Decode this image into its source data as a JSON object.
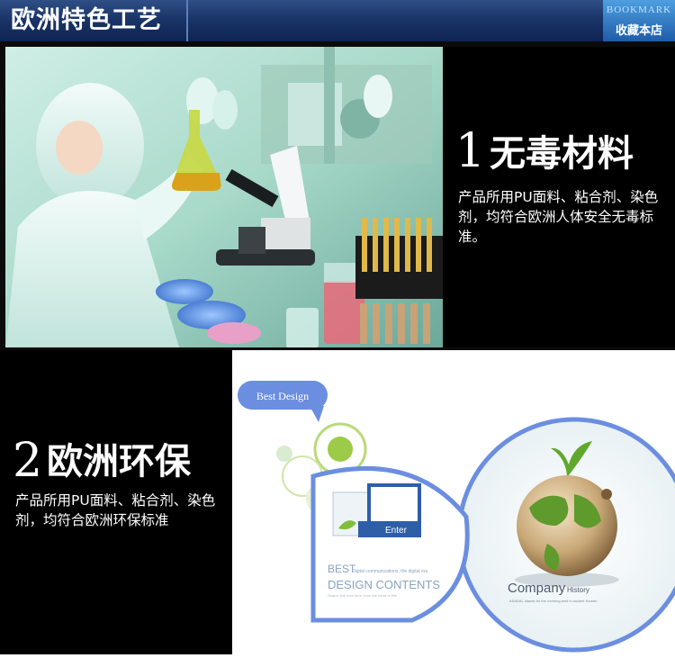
{
  "header": {
    "title": "欧洲特色工艺",
    "bookmark_en": "BOOKMARK",
    "bookmark_cn": "收藏本店"
  },
  "features": [
    {
      "number": "1",
      "title": "无毒材料",
      "desc": "产品所用PU面料、粘合剂、染色剂，均符合欧洲人体安全无毒标准。"
    },
    {
      "number": "2",
      "title": "欧洲环保",
      "desc": "产品所用PU面料、粘合剂、染色剂，均符合欧洲环保标准"
    }
  ],
  "design_panel": {
    "bubble": "Best Design",
    "enter": "Enter",
    "best": "BEST",
    "best_sub": "Digital communications, the digital era",
    "design_contents": "DESIGN CONTENTS",
    "design_small": "Search link from here, from the heart of this",
    "company": "Company",
    "history": "History",
    "company_small": "ASADAL stands for the morning land in ancient Korean"
  },
  "colors": {
    "header_dark": "#0f2352",
    "bookmark_blue": "#2f78c8",
    "accent_blue": "#5a7fdc"
  }
}
